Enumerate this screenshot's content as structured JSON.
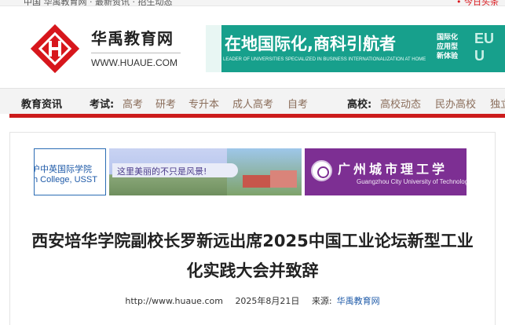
{
  "topbar": {
    "left_text": "中国 华禹教育网 · 最新资讯 · 招生动态",
    "right_text": "• 今日头条"
  },
  "header": {
    "site_name": "华禹教育网",
    "site_url": "WWW.HUAUE.COM",
    "logo_icon": "huayu-logo-icon"
  },
  "banner": {
    "title": "在地国际化,商科引航者",
    "subtitle": "LEADER OF UNIVERSITIES SPECIALIZED IN BUSINESS INTERNATIONALIZATION AT HOME",
    "side_text": [
      "国际化",
      "应用型",
      "新体验"
    ],
    "side_letters": [
      "EU",
      "U"
    ],
    "color": "#17a08c"
  },
  "nav": {
    "section_label": "教育资讯",
    "exam_label": "考试:",
    "exam_links": [
      "高考",
      "研考",
      "专升本",
      "成人高考",
      "自考"
    ],
    "college_label": "高校:",
    "college_links": [
      "高校动态",
      "民办高校",
      "独立"
    ],
    "accent_color": "#cc1b1b"
  },
  "ads": {
    "ad1_line1": "沪中英国际学院",
    "ad1_line2": "h College, USST",
    "ad2_caption": "这里美丽的不只是风景!",
    "ad3_name": "广州城市理工学",
    "ad3_english": "Guangzhou City University of Technology"
  },
  "article": {
    "title": "西安培华学院副校长罗新远出席2025中国工业论坛新型工业化实践大会并致辞",
    "url": "http://www.huaue.com",
    "date": "2025年8月21日",
    "source_label": "来源:",
    "source_name": "华禹教育网"
  }
}
